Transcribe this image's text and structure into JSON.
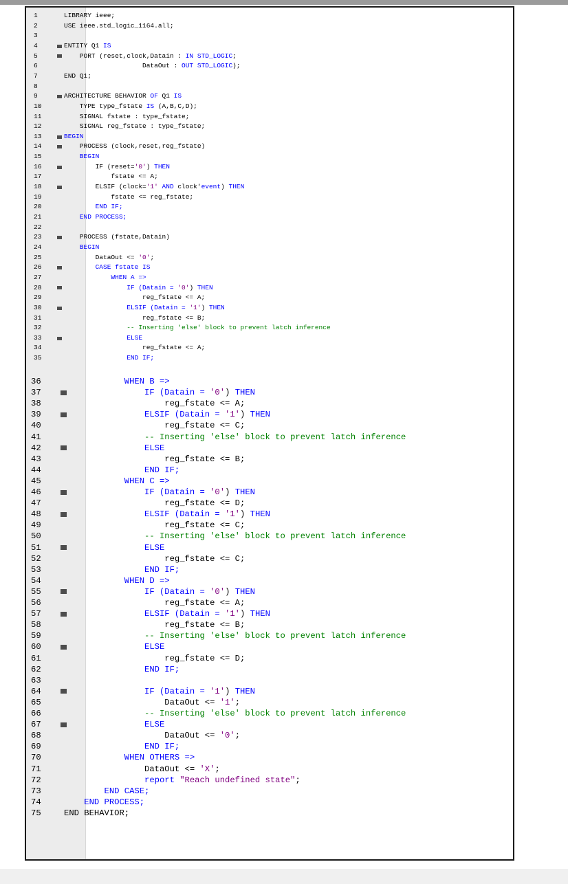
{
  "editor": {
    "colors": {
      "keyword": "#0000ff",
      "comment": "#008000",
      "string": "#800080",
      "text": "#000000"
    },
    "lines": [
      {
        "n": "1",
        "fold": false,
        "segs": [
          [
            "LIBRARY ieee;",
            "t"
          ]
        ]
      },
      {
        "n": "2",
        "fold": false,
        "segs": [
          [
            "USE ieee.std_logic_1164.all;",
            "t"
          ]
        ]
      },
      {
        "n": "3",
        "fold": false,
        "segs": []
      },
      {
        "n": "4",
        "fold": true,
        "segs": [
          [
            "ENTITY Q1 ",
            "t"
          ],
          [
            "IS",
            "k"
          ]
        ]
      },
      {
        "n": "5",
        "fold": true,
        "segs": [
          [
            "    PORT (reset,clock,Datain : ",
            "t"
          ],
          [
            "IN STD_LOGIC",
            "k"
          ],
          [
            ";",
            "t"
          ]
        ]
      },
      {
        "n": "6",
        "fold": false,
        "segs": [
          [
            "                    DataOut : ",
            "t"
          ],
          [
            "OUT STD_LOGIC",
            "k"
          ],
          [
            ");",
            "t"
          ]
        ]
      },
      {
        "n": "7",
        "fold": false,
        "segs": [
          [
            "END Q1;",
            "t"
          ]
        ]
      },
      {
        "n": "8",
        "fold": false,
        "segs": []
      },
      {
        "n": "9",
        "fold": true,
        "segs": [
          [
            "ARCHITECTURE BEHAVIOR ",
            "t"
          ],
          [
            "OF",
            "k"
          ],
          [
            " Q1 ",
            "t"
          ],
          [
            "IS",
            "k"
          ]
        ]
      },
      {
        "n": "10",
        "fold": false,
        "segs": [
          [
            "    TYPE type_fstate ",
            "t"
          ],
          [
            "IS",
            "k"
          ],
          [
            " (A,B,C,D);",
            "t"
          ]
        ]
      },
      {
        "n": "11",
        "fold": false,
        "segs": [
          [
            "    SIGNAL fstate : type_fstate;",
            "t"
          ]
        ]
      },
      {
        "n": "12",
        "fold": false,
        "segs": [
          [
            "    SIGNAL reg_fstate : type_fstate;",
            "t"
          ]
        ]
      },
      {
        "n": "13",
        "fold": true,
        "segs": [
          [
            "BEGIN",
            "k"
          ]
        ]
      },
      {
        "n": "14",
        "fold": true,
        "segs": [
          [
            "    PROCESS (clock,reset,reg_fstate)",
            "t"
          ]
        ]
      },
      {
        "n": "15",
        "fold": false,
        "segs": [
          [
            "    BEGIN",
            "k"
          ]
        ]
      },
      {
        "n": "16",
        "fold": true,
        "segs": [
          [
            "        IF (reset=",
            "t"
          ],
          [
            "'0'",
            "s"
          ],
          [
            ") ",
            "t"
          ],
          [
            "THEN",
            "k"
          ]
        ]
      },
      {
        "n": "17",
        "fold": false,
        "segs": [
          [
            "            fstate <= A;",
            "t"
          ]
        ]
      },
      {
        "n": "18",
        "fold": true,
        "segs": [
          [
            "        ELSIF (clock=",
            "t"
          ],
          [
            "'1'",
            "s"
          ],
          [
            " ",
            "t"
          ],
          [
            "AND",
            "k"
          ],
          [
            " clock'",
            "t"
          ],
          [
            "event",
            "k"
          ],
          [
            ") ",
            "t"
          ],
          [
            "THEN",
            "k"
          ]
        ]
      },
      {
        "n": "19",
        "fold": false,
        "segs": [
          [
            "            fstate <= reg_fstate;",
            "t"
          ]
        ]
      },
      {
        "n": "20",
        "fold": false,
        "segs": [
          [
            "        END IF;",
            "k"
          ]
        ]
      },
      {
        "n": "21",
        "fold": false,
        "segs": [
          [
            "    END PROCESS;",
            "k"
          ]
        ]
      },
      {
        "n": "22",
        "fold": false,
        "segs": []
      },
      {
        "n": "23",
        "fold": true,
        "segs": [
          [
            "    PROCESS (fstate,Datain)",
            "t"
          ]
        ]
      },
      {
        "n": "24",
        "fold": false,
        "segs": [
          [
            "    BEGIN",
            "k"
          ]
        ]
      },
      {
        "n": "25",
        "fold": false,
        "segs": [
          [
            "        DataOut <= ",
            "t"
          ],
          [
            "'0'",
            "s"
          ],
          [
            ";",
            "t"
          ]
        ]
      },
      {
        "n": "26",
        "fold": true,
        "segs": [
          [
            "        CASE fstate ",
            "k"
          ],
          [
            "IS",
            "k"
          ]
        ]
      },
      {
        "n": "27",
        "fold": false,
        "segs": [
          [
            "            WHEN A =>",
            "k"
          ]
        ]
      },
      {
        "n": "28",
        "fold": true,
        "segs": [
          [
            "                IF (Datain = ",
            "k"
          ],
          [
            "'0'",
            "s"
          ],
          [
            ") ",
            "t"
          ],
          [
            "THEN",
            "k"
          ]
        ]
      },
      {
        "n": "29",
        "fold": false,
        "segs": [
          [
            "                    reg_fstate <= A;",
            "t"
          ]
        ]
      },
      {
        "n": "30",
        "fold": true,
        "segs": [
          [
            "                ELSIF (Datain = ",
            "k"
          ],
          [
            "'1'",
            "s"
          ],
          [
            ") ",
            "t"
          ],
          [
            "THEN",
            "k"
          ]
        ]
      },
      {
        "n": "31",
        "fold": false,
        "segs": [
          [
            "                    reg_fstate <= B;",
            "t"
          ]
        ]
      },
      {
        "n": "32",
        "fold": false,
        "segs": [
          [
            "                -- Inserting 'else' block to prevent latch inference",
            "c"
          ]
        ]
      },
      {
        "n": "33",
        "fold": true,
        "segs": [
          [
            "                ELSE",
            "k"
          ]
        ]
      },
      {
        "n": "34",
        "fold": false,
        "segs": [
          [
            "                    reg_fstate <= A;",
            "t"
          ]
        ]
      },
      {
        "n": "35",
        "fold": false,
        "segs": [
          [
            "                END IF;",
            "k"
          ]
        ]
      },
      {
        "n": "36",
        "fold": false,
        "segs": [
          [
            "            WHEN B =>",
            "k"
          ]
        ]
      },
      {
        "n": "37",
        "fold": true,
        "segs": [
          [
            "                IF (Datain = ",
            "k"
          ],
          [
            "'0'",
            "s"
          ],
          [
            ") ",
            "t"
          ],
          [
            "THEN",
            "k"
          ]
        ]
      },
      {
        "n": "38",
        "fold": false,
        "segs": [
          [
            "                    reg_fstate <= A;",
            "t"
          ]
        ]
      },
      {
        "n": "39",
        "fold": true,
        "segs": [
          [
            "                ELSIF (Datain = ",
            "k"
          ],
          [
            "'1'",
            "s"
          ],
          [
            ") ",
            "t"
          ],
          [
            "THEN",
            "k"
          ]
        ]
      },
      {
        "n": "40",
        "fold": false,
        "segs": [
          [
            "                    reg_fstate <= C;",
            "t"
          ]
        ]
      },
      {
        "n": "41",
        "fold": false,
        "segs": [
          [
            "                -- Inserting 'else' block to prevent latch inference",
            "c"
          ]
        ]
      },
      {
        "n": "42",
        "fold": true,
        "segs": [
          [
            "                ELSE",
            "k"
          ]
        ]
      },
      {
        "n": "43",
        "fold": false,
        "segs": [
          [
            "                    reg_fstate <= B;",
            "t"
          ]
        ]
      },
      {
        "n": "44",
        "fold": false,
        "segs": [
          [
            "                END IF;",
            "k"
          ]
        ]
      },
      {
        "n": "45",
        "fold": false,
        "segs": [
          [
            "            WHEN C =>",
            "k"
          ]
        ]
      },
      {
        "n": "46",
        "fold": true,
        "segs": [
          [
            "                IF (Datain = ",
            "k"
          ],
          [
            "'0'",
            "s"
          ],
          [
            ") ",
            "t"
          ],
          [
            "THEN",
            "k"
          ]
        ]
      },
      {
        "n": "47",
        "fold": false,
        "segs": [
          [
            "                    reg_fstate <= D;",
            "t"
          ]
        ]
      },
      {
        "n": "48",
        "fold": true,
        "segs": [
          [
            "                ELSIF (Datain = ",
            "k"
          ],
          [
            "'1'",
            "s"
          ],
          [
            ") ",
            "t"
          ],
          [
            "THEN",
            "k"
          ]
        ]
      },
      {
        "n": "49",
        "fold": false,
        "segs": [
          [
            "                    reg_fstate <= C;",
            "t"
          ]
        ]
      },
      {
        "n": "50",
        "fold": false,
        "segs": [
          [
            "                -- Inserting 'else' block to prevent latch inference",
            "c"
          ]
        ]
      },
      {
        "n": "51",
        "fold": true,
        "segs": [
          [
            "                ELSE",
            "k"
          ]
        ]
      },
      {
        "n": "52",
        "fold": false,
        "segs": [
          [
            "                    reg_fstate <= C;",
            "t"
          ]
        ]
      },
      {
        "n": "53",
        "fold": false,
        "segs": [
          [
            "                END IF;",
            "k"
          ]
        ]
      },
      {
        "n": "54",
        "fold": false,
        "segs": [
          [
            "            WHEN D =>",
            "k"
          ]
        ]
      },
      {
        "n": "55",
        "fold": true,
        "segs": [
          [
            "                IF (Datain = ",
            "k"
          ],
          [
            "'0'",
            "s"
          ],
          [
            ") ",
            "t"
          ],
          [
            "THEN",
            "k"
          ]
        ]
      },
      {
        "n": "56",
        "fold": false,
        "segs": [
          [
            "                    reg_fstate <= A;",
            "t"
          ]
        ]
      },
      {
        "n": "57",
        "fold": true,
        "segs": [
          [
            "                ELSIF (Datain = ",
            "k"
          ],
          [
            "'1'",
            "s"
          ],
          [
            ") ",
            "t"
          ],
          [
            "THEN",
            "k"
          ]
        ]
      },
      {
        "n": "58",
        "fold": false,
        "segs": [
          [
            "                    reg_fstate <= B;",
            "t"
          ]
        ]
      },
      {
        "n": "59",
        "fold": false,
        "segs": [
          [
            "                -- Inserting 'else' block to prevent latch inference",
            "c"
          ]
        ]
      },
      {
        "n": "60",
        "fold": true,
        "segs": [
          [
            "                ELSE",
            "k"
          ]
        ]
      },
      {
        "n": "61",
        "fold": false,
        "segs": [
          [
            "                    reg_fstate <= D;",
            "t"
          ]
        ]
      },
      {
        "n": "62",
        "fold": false,
        "segs": [
          [
            "                END IF;",
            "k"
          ]
        ]
      },
      {
        "n": "63",
        "fold": false,
        "segs": []
      },
      {
        "n": "64",
        "fold": true,
        "segs": [
          [
            "                IF (Datain = ",
            "k"
          ],
          [
            "'1'",
            "s"
          ],
          [
            ") ",
            "t"
          ],
          [
            "THEN",
            "k"
          ]
        ]
      },
      {
        "n": "65",
        "fold": false,
        "segs": [
          [
            "                    DataOut <= ",
            "t"
          ],
          [
            "'1'",
            "s"
          ],
          [
            ";",
            "t"
          ]
        ]
      },
      {
        "n": "66",
        "fold": false,
        "segs": [
          [
            "                -- Inserting 'else' block to prevent latch inference",
            "c"
          ]
        ]
      },
      {
        "n": "67",
        "fold": true,
        "segs": [
          [
            "                ELSE",
            "k"
          ]
        ]
      },
      {
        "n": "68",
        "fold": false,
        "segs": [
          [
            "                    DataOut <= ",
            "t"
          ],
          [
            "'0'",
            "s"
          ],
          [
            ";",
            "t"
          ]
        ]
      },
      {
        "n": "69",
        "fold": false,
        "segs": [
          [
            "                END IF;",
            "k"
          ]
        ]
      },
      {
        "n": "70",
        "fold": false,
        "segs": [
          [
            "            WHEN OTHERS =>",
            "k"
          ]
        ]
      },
      {
        "n": "71",
        "fold": false,
        "segs": [
          [
            "                DataOut <= ",
            "t"
          ],
          [
            "'X'",
            "s"
          ],
          [
            ";",
            "t"
          ]
        ]
      },
      {
        "n": "72",
        "fold": false,
        "segs": [
          [
            "                report ",
            "k"
          ],
          [
            "\"Reach undefined state\"",
            "s"
          ],
          [
            ";",
            "t"
          ]
        ]
      },
      {
        "n": "73",
        "fold": false,
        "segs": [
          [
            "        END CASE;",
            "k"
          ]
        ]
      },
      {
        "n": "74",
        "fold": false,
        "segs": [
          [
            "    END PROCESS;",
            "k"
          ]
        ]
      },
      {
        "n": "75",
        "fold": false,
        "segs": [
          [
            "END BEHAVIOR;",
            "t"
          ]
        ]
      }
    ]
  }
}
